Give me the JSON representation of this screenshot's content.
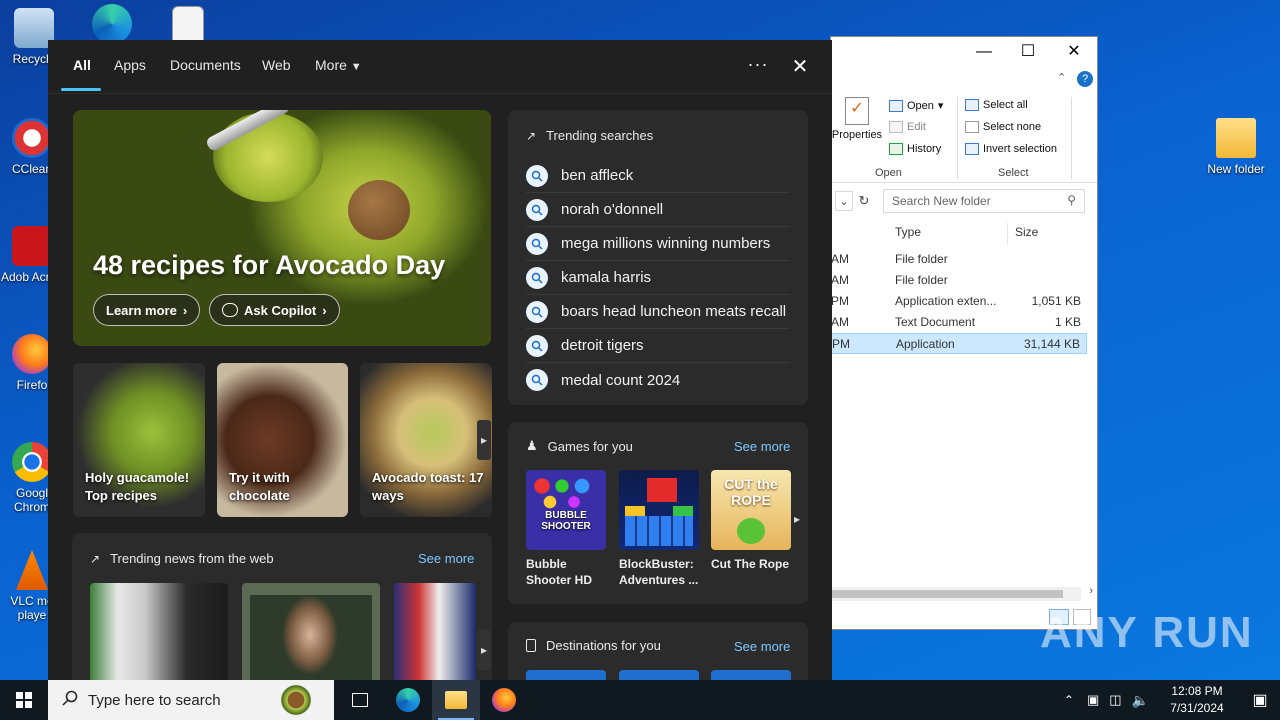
{
  "desktop": {
    "icons_left": [
      {
        "label": "Recycle",
        "icon": "recycle-bin-icon"
      },
      {
        "label": "CClean",
        "icon": "ccleaner-icon"
      },
      {
        "label": "Adob Acrob",
        "icon": "acrobat-icon"
      },
      {
        "label": "Firefo",
        "icon": "firefox-icon"
      },
      {
        "label": "Googl Chrom",
        "icon": "chrome-icon"
      },
      {
        "label": "VLC me playe",
        "icon": "vlc-icon"
      }
    ],
    "icon_right": {
      "label": "New folder",
      "icon": "folder-icon"
    }
  },
  "explorer": {
    "ribbon": {
      "properties": "Properties",
      "open": "Open",
      "edit": "Edit",
      "history": "History",
      "select_all": "Select all",
      "select_none": "Select none",
      "invert_selection": "Invert selection",
      "group_open": "Open",
      "group_select": "Select"
    },
    "search_placeholder": "Search New folder",
    "columns": {
      "type": "Type",
      "size": "Size"
    },
    "rows": [
      {
        "date": "AM",
        "type": "File folder",
        "size": ""
      },
      {
        "date": "AM",
        "type": "File folder",
        "size": ""
      },
      {
        "date": "PM",
        "type": "Application exten...",
        "size": "1,051 KB"
      },
      {
        "date": "AM",
        "type": "Text Document",
        "size": "1 KB"
      },
      {
        "date": "PM",
        "type": "Application",
        "size": "31,144 KB"
      }
    ]
  },
  "search_panel": {
    "tabs": [
      "All",
      "Apps",
      "Documents",
      "Web",
      "More"
    ],
    "hero": {
      "title": "48 recipes for Avocado Day",
      "learn_more": "Learn more",
      "ask_copilot": "Ask Copilot"
    },
    "cards": [
      {
        "caption": "Holy guacamole! Top recipes"
      },
      {
        "caption": "Try it with chocolate"
      },
      {
        "caption": "Avocado toast: 17 ways"
      }
    ],
    "trending_searches": {
      "title": "Trending searches",
      "items": [
        "ben affleck",
        "norah o'donnell",
        "mega millions winning numbers",
        "kamala harris",
        "boars head luncheon meats recall",
        "detroit tigers",
        "medal count 2024"
      ]
    },
    "games": {
      "title": "Games for you",
      "see_more": "See more",
      "items": [
        {
          "name": "Bubble Shooter HD",
          "thumb_text": "BUBBLE SHOOTER"
        },
        {
          "name": "BlockBuster: Adventures ...",
          "thumb_text": ""
        },
        {
          "name": "Cut The Rope",
          "thumb_text": "CUT the ROPE"
        }
      ]
    },
    "news": {
      "title": "Trending news from the web",
      "see_more": "See more"
    },
    "destinations": {
      "title": "Destinations for you",
      "see_more": "See more"
    }
  },
  "taskbar": {
    "search_placeholder": "Type here to search",
    "time": "12:08 PM",
    "date": "7/31/2024"
  },
  "watermark": "ANY RUN"
}
